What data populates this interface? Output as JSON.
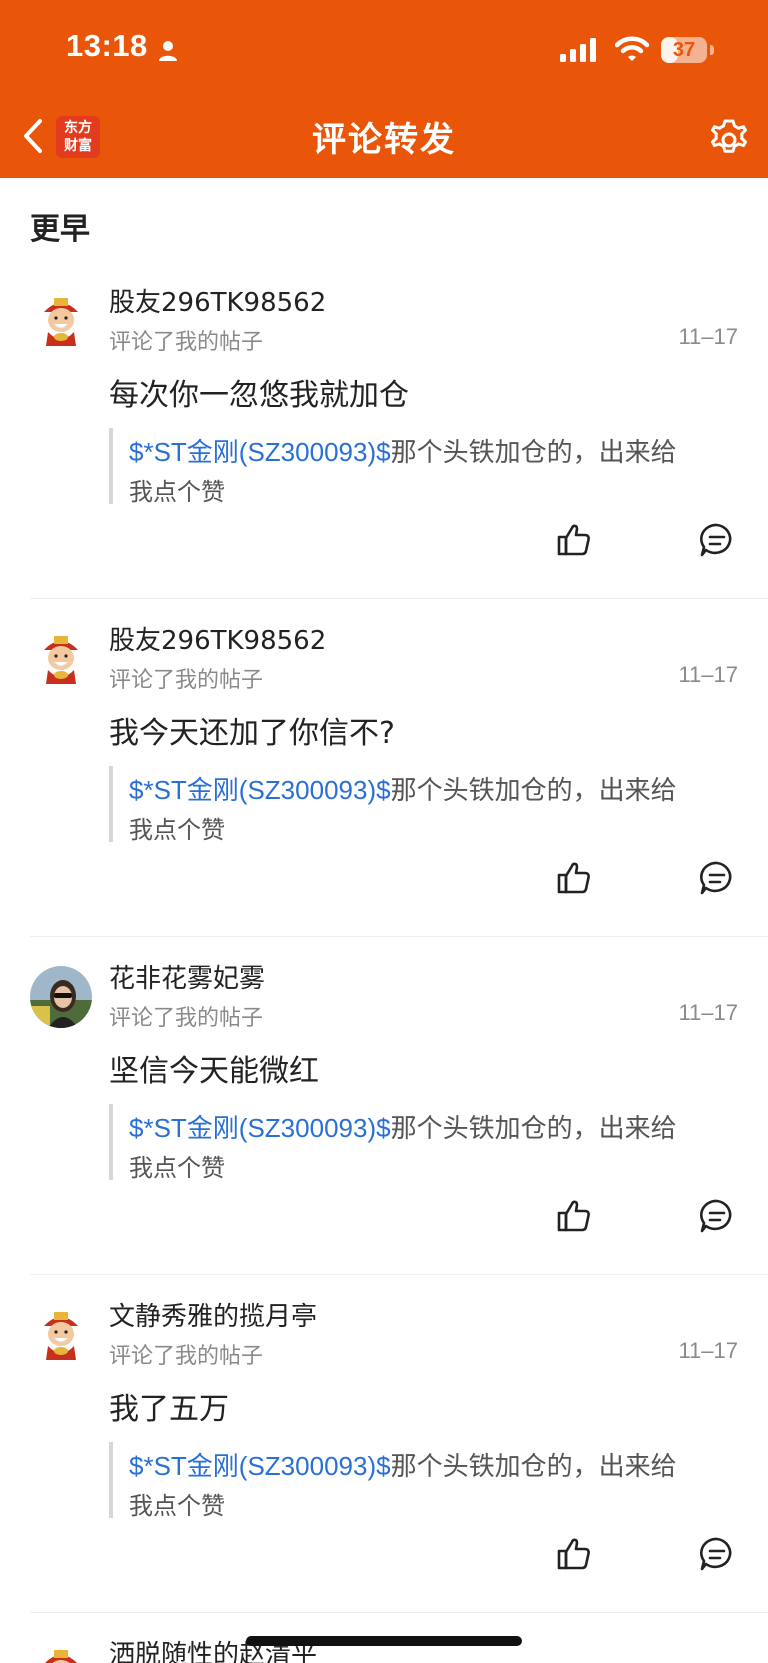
{
  "status_bar": {
    "time": "13:18",
    "battery": "37",
    "battery_level": 0.37
  },
  "header": {
    "title": "评论转发",
    "logo_line1": "东方",
    "logo_line2": "财富"
  },
  "section": {
    "title": "更早"
  },
  "comments": [
    {
      "username": "股友296TK98562",
      "action": "评论了我的帖子",
      "date": "11–17",
      "text": "每次你一忽悠我就加仓",
      "quote_link": "$*ST金刚(SZ300093)$",
      "quote_rest": "那个头铁加仓的，出来给",
      "quote_line2": "我点个赞",
      "avatar": "cartoon-avatar"
    },
    {
      "username": "股友296TK98562",
      "action": "评论了我的帖子",
      "date": "11–17",
      "text": "我今天还加了你信不?",
      "quote_link": "$*ST金刚(SZ300093)$",
      "quote_rest": "那个头铁加仓的，出来给",
      "quote_line2": "我点个赞",
      "avatar": "cartoon-avatar"
    },
    {
      "username": "花非花雾妃雾",
      "action": "评论了我的帖子",
      "date": "11–17",
      "text": "坚信今天能微红",
      "quote_link": "$*ST金刚(SZ300093)$",
      "quote_rest": "那个头铁加仓的，出来给",
      "quote_line2": "我点个赞",
      "avatar": "photo-avatar"
    },
    {
      "username": "文静秀雅的揽月亭",
      "action": "评论了我的帖子",
      "date": "11–17",
      "text": "我了五万",
      "quote_link": "$*ST金刚(SZ300093)$",
      "quote_rest": "那个头铁加仓的，出来给",
      "quote_line2": "我点个赞",
      "avatar": "cartoon-avatar"
    }
  ],
  "partial_comment": {
    "username": "洒脱随性的赵清平"
  },
  "icons": {
    "back": "chevron-left-icon",
    "settings": "gear-icon",
    "like": "thumbs-up-icon",
    "reply": "comment-bubble-icon"
  },
  "colors": {
    "header": "#e9560a",
    "link": "#2a6fd6"
  }
}
